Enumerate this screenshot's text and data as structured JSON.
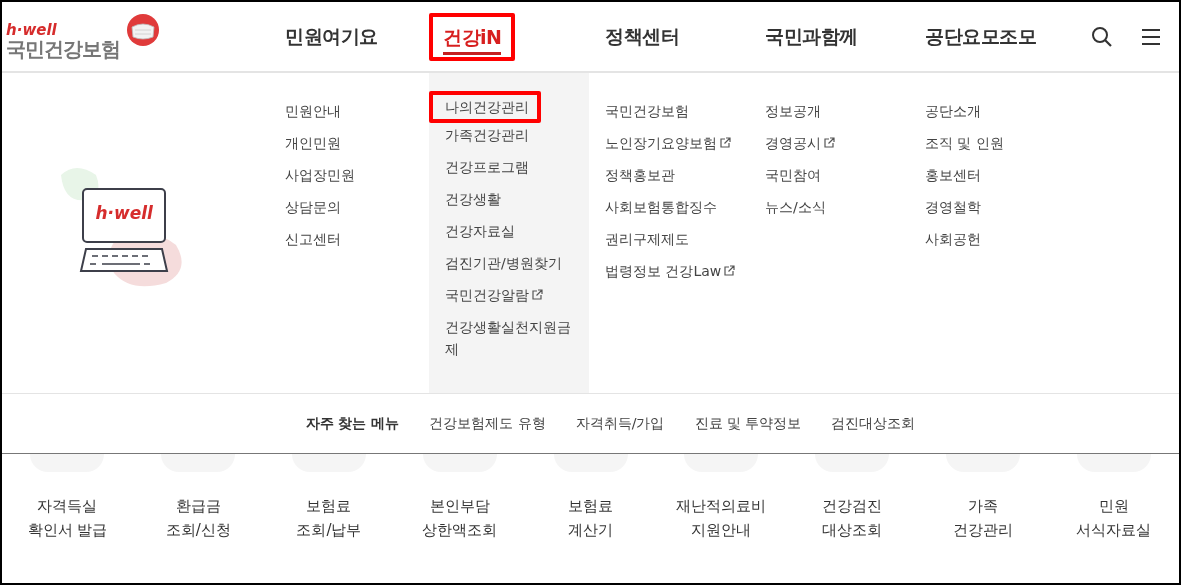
{
  "logo": {
    "tagline": "h·well",
    "name": "국민건강보험"
  },
  "nav": [
    {
      "label": "민원여기요",
      "selected": false,
      "highlighted": false
    },
    {
      "label": "건강iN",
      "selected": true,
      "highlighted": true
    },
    {
      "label": "정책센터",
      "selected": false,
      "highlighted": false
    },
    {
      "label": "국민과함께",
      "selected": false,
      "highlighted": false
    },
    {
      "label": "공단요모조모",
      "selected": false,
      "highlighted": false
    }
  ],
  "illustration": {
    "screen_text": "h·well"
  },
  "menu_columns": [
    {
      "items": [
        {
          "label": "민원안내",
          "external": false,
          "highlighted": false
        },
        {
          "label": "개인민원",
          "external": false,
          "highlighted": false
        },
        {
          "label": "사업장민원",
          "external": false,
          "highlighted": false
        },
        {
          "label": "상담문의",
          "external": false,
          "highlighted": false
        },
        {
          "label": "신고센터",
          "external": false,
          "highlighted": false
        }
      ]
    },
    {
      "items": [
        {
          "label": "나의건강관리",
          "external": false,
          "highlighted": true
        },
        {
          "label": "가족건강관리",
          "external": false,
          "highlighted": false
        },
        {
          "label": "건강프로그램",
          "external": false,
          "highlighted": false
        },
        {
          "label": "건강생활",
          "external": false,
          "highlighted": false
        },
        {
          "label": "건강자료실",
          "external": false,
          "highlighted": false
        },
        {
          "label": "검진기관/병원찾기",
          "external": false,
          "highlighted": false
        },
        {
          "label": "국민건강알람",
          "external": true,
          "highlighted": false
        },
        {
          "label": "건강생활실천지원금제",
          "external": false,
          "highlighted": false
        }
      ]
    },
    {
      "items": [
        {
          "label": "국민건강보험",
          "external": false,
          "highlighted": false
        },
        {
          "label": "노인장기요양보험",
          "external": true,
          "highlighted": false
        },
        {
          "label": "정책홍보관",
          "external": false,
          "highlighted": false
        },
        {
          "label": "사회보험통합징수",
          "external": false,
          "highlighted": false
        },
        {
          "label": "권리구제제도",
          "external": false,
          "highlighted": false
        },
        {
          "label": "법령정보 건강Law",
          "external": true,
          "highlighted": false
        }
      ]
    },
    {
      "items": [
        {
          "label": "정보공개",
          "external": false,
          "highlighted": false
        },
        {
          "label": "경영공시",
          "external": true,
          "highlighted": false
        },
        {
          "label": "국민참여",
          "external": false,
          "highlighted": false
        },
        {
          "label": "뉴스/소식",
          "external": false,
          "highlighted": false
        }
      ]
    },
    {
      "items": [
        {
          "label": "공단소개",
          "external": false,
          "highlighted": false
        },
        {
          "label": "조직 및 인원",
          "external": false,
          "highlighted": false
        },
        {
          "label": "홍보센터",
          "external": false,
          "highlighted": false
        },
        {
          "label": "경영철학",
          "external": false,
          "highlighted": false
        },
        {
          "label": "사회공헌",
          "external": false,
          "highlighted": false
        }
      ]
    }
  ],
  "frequent_menu": {
    "title": "자주 찾는 메뉴",
    "links": [
      "건강보험제도 유형",
      "자격취득/가입",
      "진료 및 투약정보",
      "검진대상조회"
    ]
  },
  "quick_links": [
    {
      "line1": "자격득실",
      "line2": "확인서 발급"
    },
    {
      "line1": "환급금",
      "line2": "조회/신청"
    },
    {
      "line1": "보험료",
      "line2": "조회/납부"
    },
    {
      "line1": "본인부담",
      "line2": "상한액조회"
    },
    {
      "line1": "보험료",
      "line2": "계산기"
    },
    {
      "line1": "재난적의료비",
      "line2": "지원안내"
    },
    {
      "line1": "건강검진",
      "line2": "대상조회"
    },
    {
      "line1": "가족",
      "line2": "건강관리"
    },
    {
      "line1": "민원",
      "line2": "서식자료실"
    }
  ]
}
